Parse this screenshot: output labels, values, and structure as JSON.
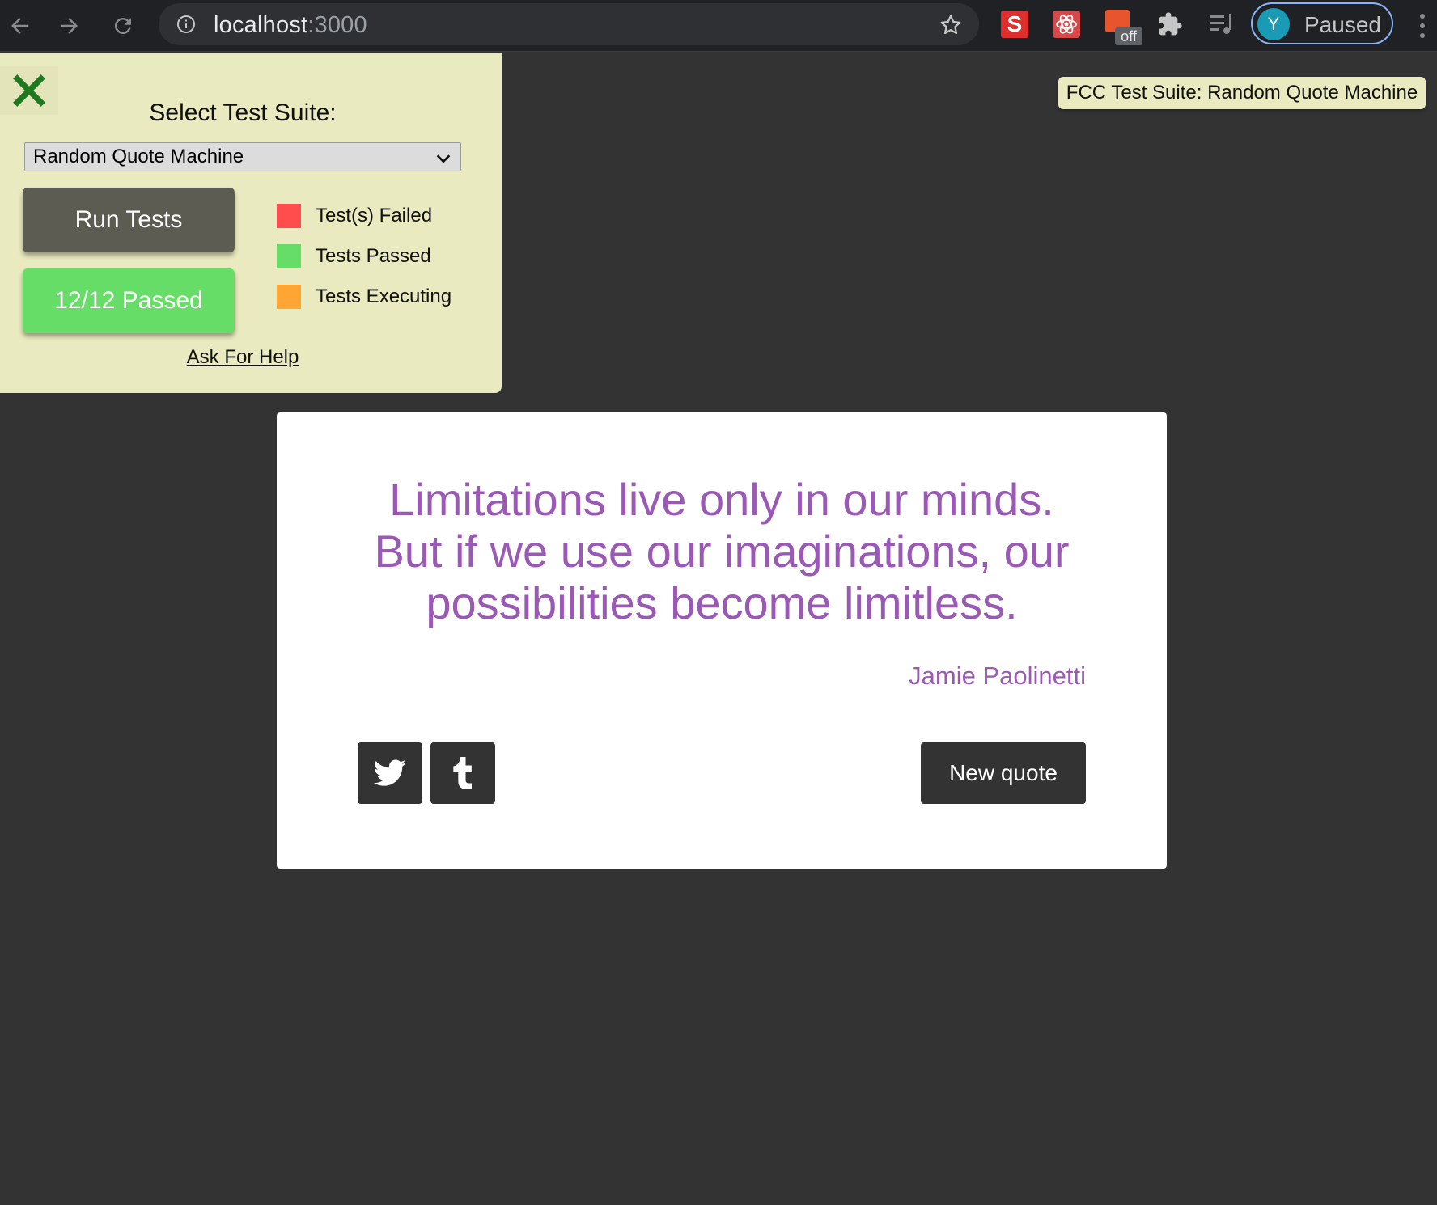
{
  "browser": {
    "url_host": "localhost",
    "url_port": ":3000",
    "profile_initial": "Y",
    "profile_status": "Paused",
    "extension_off_badge": "off"
  },
  "test_panel": {
    "select_label": "Select Test Suite:",
    "selected_suite": "Random Quote Machine",
    "run_button": "Run Tests",
    "result_button": "12/12 Passed",
    "legend": [
      {
        "label": "Test(s) Failed",
        "color": "#ff4d4d"
      },
      {
        "label": "Tests Passed",
        "color": "#66dd66"
      },
      {
        "label": "Tests Executing",
        "color": "#ffa533"
      }
    ],
    "help_link": "Ask For Help",
    "suite_tag": "FCC Test Suite: Random Quote Machine"
  },
  "quote": {
    "lines": [
      "Limitations live only in our minds.",
      "But if we use our imaginations, our",
      "possibilities become limitless."
    ],
    "author": "Jamie Paolinetti",
    "new_quote_button": "New quote",
    "text_color": "#9b59b6"
  }
}
